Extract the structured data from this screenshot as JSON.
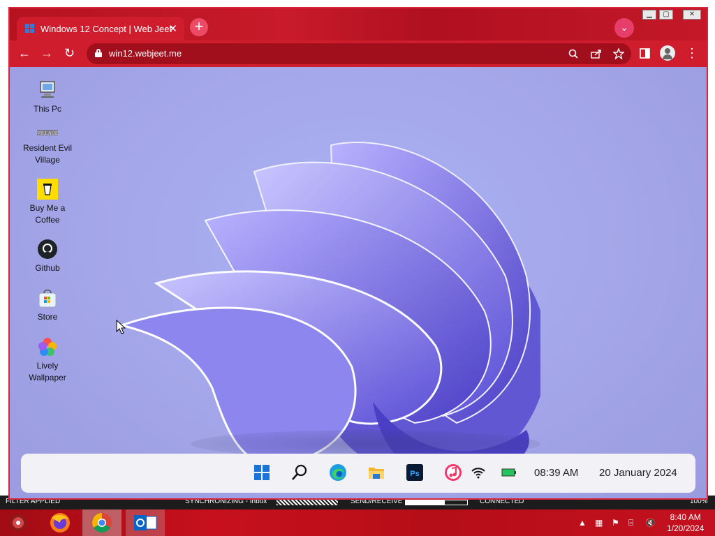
{
  "browser": {
    "tab_title": "Windows 12 Concept | Web Jeet",
    "tab_close": "✕",
    "new_tab": "+",
    "url": "win12.webjeet.me",
    "back": "←",
    "forward": "→",
    "reload": "↻",
    "menu": "⋮"
  },
  "desktop_icons": [
    {
      "label": "This Pc"
    },
    {
      "label": "Resident Evil Village"
    },
    {
      "label": "Buy Me a Coffee"
    },
    {
      "label": "Github"
    },
    {
      "label": "Store"
    },
    {
      "label": "Lively Wallpaper"
    }
  ],
  "taskbar": {
    "time": "08:39 AM",
    "date": "20 January 2024",
    "ps_label": "Ps"
  },
  "outlook_status": {
    "filter": "FILTER APPLIED",
    "sync": "SYNCHRONIZING - Inbox",
    "sendreceive": "SEND/RECEIVE",
    "connected": "CONNECTED",
    "zoom": "100%"
  },
  "system_tray": {
    "time": "8:40 AM",
    "date": "1/20/2024"
  },
  "colors": {
    "chrome_frame": "#c21528",
    "wallpaper": "#a5a8ea",
    "taskbar": "#f2f2f6"
  }
}
